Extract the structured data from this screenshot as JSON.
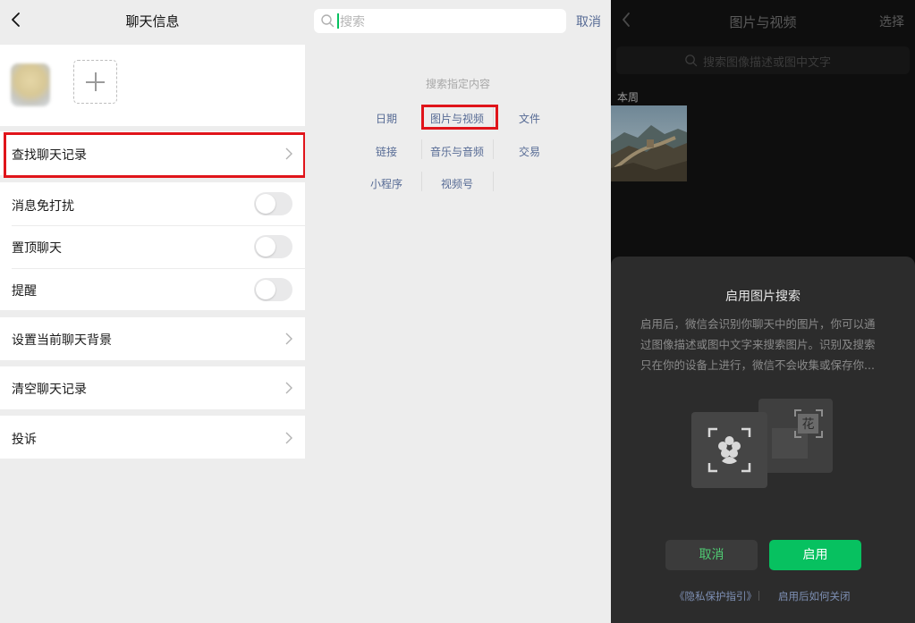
{
  "colors": {
    "accent_green": "#07c160",
    "link_blue": "#576b95",
    "highlight_red": "#e0141a",
    "dark_background": "#0e0e0e",
    "sheet_background": "#2c2c2c"
  },
  "chat_info": {
    "title": "聊天信息",
    "find_history_label": "查找聊天记录",
    "toggles": [
      {
        "label": "消息免打扰",
        "on": false
      },
      {
        "label": "置顶聊天",
        "on": false
      },
      {
        "label": "提醒",
        "on": false
      }
    ],
    "set_background_label": "设置当前聊天背景",
    "clear_history_label": "清空聊天记录",
    "report_label": "投诉"
  },
  "search": {
    "placeholder": "搜索",
    "cancel_label": "取消",
    "hint": "搜索指定内容",
    "categories": [
      "日期",
      "图片与视频",
      "文件",
      "链接",
      "音乐与音频",
      "交易",
      "小程序",
      "视频号"
    ],
    "highlighted_category": "图片与视频"
  },
  "media": {
    "title": "图片与视频",
    "select_label": "选择",
    "search_placeholder": "搜索图像描述或图中文字",
    "section_label": "本周",
    "dialog": {
      "title": "启用图片搜索",
      "body_lines": [
        "启用后，微信会识别你聊天中的图片，你可以通",
        "过图像描述或图中文字来搜索图片。识别及搜索",
        "只在你的设备上进行，微信不会收集或保存你..."
      ],
      "illustration_char": "花",
      "cancel_label": "取消",
      "enable_label": "启用",
      "privacy_link": "《隐私保护指引》",
      "how_to_disable_link": "启用后如何关闭"
    }
  }
}
